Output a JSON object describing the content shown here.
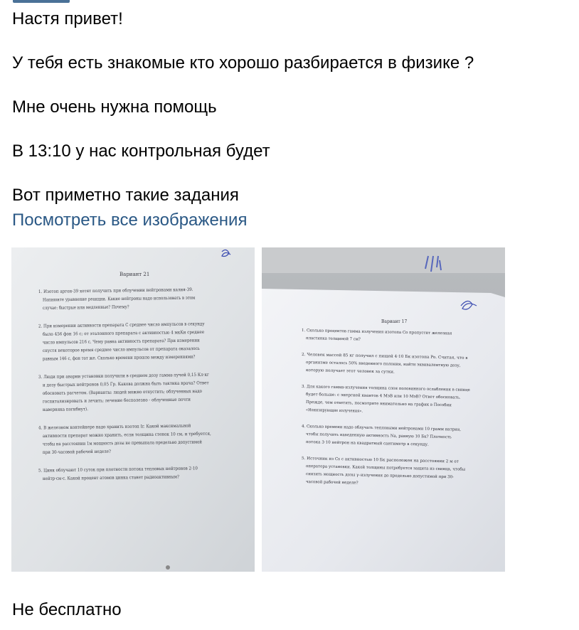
{
  "messages": [
    "Настя привет!",
    "У тебя есть знакомые кто хорошо разбирается в физике ?",
    "Мне очень нужна помощь",
    "В 13:10 у нас контрольная будет",
    "Вот приметно такие задания"
  ],
  "view_all_images_link": "Посмотреть все изображения",
  "photos": [
    {
      "title": "Вариант 21",
      "lines": [
        "1. Изотоп аргон-39 хотят получить при облучении нейтронами калия-39.",
        "Напишите уравнение реакции. Какие нейтроны надо использовать в этом",
        "случае: быстрые или медленные? Почему?",
        "2. При измерении активности препарата C среднее число импульсов в секунду",
        "было 456 фон 16 с; от эталонного препарата с активностью 4 мкКи среднее",
        "число импульсов 216 с. Чему равна активность препарата? При измерении",
        "спустя некоторое время среднее число импульсов от препарата оказалось",
        "равным 146 с, фон тот же. Сколько времени прошло между измерениями?",
        "3. Люди при аварии установки получили в среднем дозу гамма-лучей 0,15 Кл·кг",
        "и дозу быстрых нейтронов 0,05 Гр. Какова должна быть тактика врача? Ответ",
        "обосновать расчетом. (Варианты: людей можно отпустить; облученных надо",
        "госпитализировать и лечить; лечение бесполезно - облученные почти",
        "наверняка погибнут).",
        "4. В железном контейнере надо хранить изотоп Ir. Какой максимальной",
        "активности препарат можно хранить, если толщина стенок 10 см, и требуется,",
        "чтобы на расстоянии 1м мощность дозы не превышала предельно допустимой",
        "при 30-часовой рабочей неделе?",
        "5. Цинк облучают 10 суток при плотности потока тепловых нейтронов 2·10",
        "нейтр·см·с. Какой процент атомов цинка станет радиоактивным?"
      ]
    },
    {
      "title": "Вариант 17",
      "lines": [
        "1. Сколько процентов гамма излучения изотопа Co пропустит железная",
        "пластинка толщиной 7 см?",
        "2. Человек массой 85 кг получил с пищей 4·10 Бк изотопа Po. Считая, что в",
        "организме осталось 50% введенного полония, найти эквивалентную дозу,",
        "которую получает этот человек за сутки.",
        "3. Для какого гамма-излучения толщина слоя половинного ослабления в свинце",
        "будет больше: с энергией квантов 4 МэВ или 10 МэВ? Ответ обосновать.",
        "Прежде, чем ответить, посмотрите внимательно на график в Пособии",
        "«Ионизирующие излучения».",
        "4. Сколько времени надо облучать тепловыми нейтронами 10 грамм натрия,",
        "чтобы получить наведенную активность Na, равную 10 Бк? Плотность",
        "потока 3·10 нейтрон на квадратный сантиметр в секунду.",
        "5. Источник из Cs с активностью 10 Бк расположен на расстоянии 2 м от",
        "оператора установки. Какой толщины потребуется защита из свинца, чтобы",
        "снизить мощность дозы γ–излучения до предельно допустимой при 30-",
        "часовой рабочей неделе?"
      ]
    }
  ],
  "last_message": "Не бесплатно",
  "colors": {
    "link": "#2a5885",
    "text": "#000000"
  }
}
